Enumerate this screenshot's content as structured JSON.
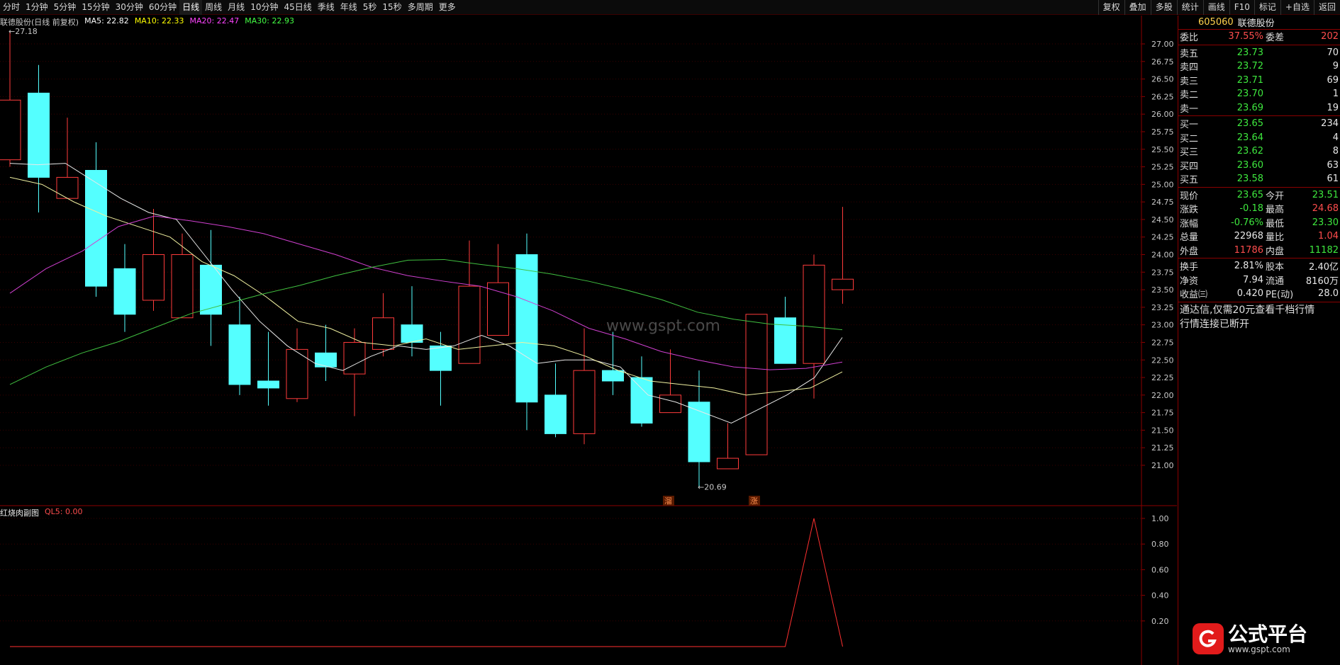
{
  "toolbar": {
    "periods": [
      "分时",
      "1分钟",
      "5分钟",
      "15分钟",
      "30分钟",
      "60分钟",
      "日线",
      "周线",
      "月线",
      "10分钟",
      "45日线",
      "季线",
      "年线",
      "5秒",
      "15秒",
      "多周期",
      "更多"
    ],
    "active_period": "日线",
    "right_buttons": [
      "复权",
      "叠加",
      "多股",
      "统计",
      "画线",
      "F10",
      "标记",
      "+自选",
      "返回"
    ]
  },
  "legend": {
    "title": "联德股份(日线 前复权)",
    "ma5": "MA5: 22.82",
    "ma10": "MA10: 22.33",
    "ma20": "MA20: 22.47",
    "ma30": "MA30: 22.93",
    "high_marker": "27.18",
    "low_marker": "20.69",
    "tag1": "溜",
    "tag2": "涨"
  },
  "sub_legend": {
    "title": "红烧肉副图",
    "ql5": "QL5: 0.00"
  },
  "watermark": "www.gspt.com",
  "colors": {
    "up": "#ff3b3b",
    "down": "#54ffff",
    "ma5": "#ffffff",
    "ma10": "#ffff00",
    "ma20": "#ff44ff",
    "ma30": "#44ff44",
    "grid": "#3a0000",
    "axis": "#8b0000"
  },
  "chart_data": [
    {
      "type": "candlestick",
      "title": "联德股份(日线 前复权)",
      "y_ticks": [
        21.0,
        21.25,
        21.5,
        21.75,
        22.0,
        22.25,
        22.5,
        22.75,
        23.0,
        23.25,
        23.5,
        23.75,
        24.0,
        24.25,
        24.5,
        24.75,
        25.0,
        25.25,
        25.5,
        25.75,
        26.0,
        26.25,
        26.5,
        26.75,
        27.0
      ],
      "ylim": [
        20.5,
        27.2
      ],
      "candles": [
        {
          "o": 25.35,
          "c": 26.2,
          "h": 27.18,
          "l": 25.25
        },
        {
          "o": 26.3,
          "c": 25.1,
          "h": 26.7,
          "l": 24.6
        },
        {
          "o": 24.8,
          "c": 25.1,
          "h": 25.95,
          "l": 24.8
        },
        {
          "o": 25.2,
          "c": 23.55,
          "h": 25.6,
          "l": 23.4
        },
        {
          "o": 23.8,
          "c": 23.15,
          "h": 24.15,
          "l": 22.9
        },
        {
          "o": 23.35,
          "c": 24.0,
          "h": 24.65,
          "l": 23.2
        },
        {
          "o": 23.1,
          "c": 24.0,
          "h": 24.3,
          "l": 23.1
        },
        {
          "o": 23.85,
          "c": 23.15,
          "h": 24.35,
          "l": 22.7
        },
        {
          "o": 23.0,
          "c": 22.15,
          "h": 23.4,
          "l": 22.0
        },
        {
          "o": 22.2,
          "c": 22.1,
          "h": 22.9,
          "l": 21.85
        },
        {
          "o": 21.95,
          "c": 22.65,
          "h": 22.95,
          "l": 21.9
        },
        {
          "o": 22.6,
          "c": 22.4,
          "h": 23.0,
          "l": 22.2
        },
        {
          "o": 22.3,
          "c": 22.75,
          "h": 22.95,
          "l": 21.7
        },
        {
          "o": 22.65,
          "c": 23.1,
          "h": 23.45,
          "l": 22.55
        },
        {
          "o": 23.0,
          "c": 22.75,
          "h": 23.55,
          "l": 22.55
        },
        {
          "o": 22.7,
          "c": 22.35,
          "h": 22.9,
          "l": 21.85
        },
        {
          "o": 22.45,
          "c": 23.55,
          "h": 24.2,
          "l": 22.45
        },
        {
          "o": 22.85,
          "c": 23.6,
          "h": 24.15,
          "l": 22.85
        },
        {
          "o": 24.0,
          "c": 21.9,
          "h": 24.3,
          "l": 21.5
        },
        {
          "o": 22.0,
          "c": 21.45,
          "h": 22.45,
          "l": 21.4
        },
        {
          "o": 21.45,
          "c": 22.35,
          "h": 22.95,
          "l": 21.3
        },
        {
          "o": 22.35,
          "c": 22.2,
          "h": 22.9,
          "l": 22.0
        },
        {
          "o": 22.25,
          "c": 21.6,
          "h": 22.55,
          "l": 21.55
        },
        {
          "o": 21.75,
          "c": 22.0,
          "h": 22.65,
          "l": 21.75
        },
        {
          "o": 21.9,
          "c": 21.05,
          "h": 22.35,
          "l": 20.69
        },
        {
          "o": 20.95,
          "c": 21.1,
          "h": 21.6,
          "l": 20.95
        },
        {
          "o": 21.15,
          "c": 23.15,
          "h": 23.15,
          "l": 21.15
        },
        {
          "o": 23.1,
          "c": 22.45,
          "h": 23.4,
          "l": 22.45
        },
        {
          "o": 22.45,
          "c": 23.85,
          "h": 24.0,
          "l": 21.95
        },
        {
          "o": 23.5,
          "c": 23.65,
          "h": 24.68,
          "l": 23.3
        }
      ],
      "ma5": [
        25.3,
        25.28,
        25.3,
        25.05,
        24.8,
        24.6,
        24.5,
        24.0,
        23.5,
        23.05,
        22.7,
        22.45,
        22.35,
        22.55,
        22.7,
        22.65,
        22.7,
        22.85,
        22.7,
        22.45,
        22.5,
        22.5,
        22.4,
        22.0,
        21.9,
        21.75,
        21.6,
        21.8,
        22.0,
        22.25,
        22.82
      ],
      "ma10": [
        25.1,
        25.0,
        24.75,
        24.55,
        24.4,
        24.25,
        23.9,
        23.7,
        23.4,
        23.05,
        22.95,
        22.75,
        22.7,
        22.8,
        22.65,
        22.7,
        22.75,
        22.7,
        22.55,
        22.35,
        22.2,
        22.15,
        22.1,
        22.0,
        22.05,
        22.1,
        22.33
      ],
      "ma20": [
        23.45,
        23.8,
        24.05,
        24.4,
        24.55,
        24.48,
        24.4,
        24.3,
        24.15,
        24.0,
        23.82,
        23.7,
        23.62,
        23.55,
        23.4,
        23.2,
        22.95,
        22.8,
        22.62,
        22.5,
        22.4,
        22.36,
        22.38,
        22.47
      ],
      "ma30": [
        22.15,
        22.4,
        22.6,
        22.76,
        22.96,
        23.16,
        23.3,
        23.44,
        23.56,
        23.7,
        23.82,
        23.92,
        23.93,
        23.86,
        23.8,
        23.72,
        23.62,
        23.5,
        23.36,
        23.18,
        23.08,
        23.01,
        22.98,
        22.93
      ]
    },
    {
      "type": "line",
      "title": "红烧肉副图",
      "y_ticks": [
        0.2,
        0.4,
        0.6,
        0.8,
        1.0
      ],
      "series": [
        {
          "name": "QL5",
          "values": [
            0,
            0,
            0,
            0,
            0,
            0,
            0,
            0,
            0,
            0,
            0,
            0,
            0,
            0,
            0,
            0,
            0,
            0,
            0,
            0,
            0,
            0,
            0,
            0,
            0,
            0,
            0,
            0,
            1,
            0
          ]
        }
      ]
    }
  ],
  "quote": {
    "code": "605060",
    "name": "联德股份",
    "weibi_label": "委比",
    "weibi": "37.55%",
    "weicha_label": "委差",
    "weicha": "202",
    "sells": [
      {
        "label": "卖五",
        "price": "23.73",
        "vol": "70"
      },
      {
        "label": "卖四",
        "price": "23.72",
        "vol": "9"
      },
      {
        "label": "卖三",
        "price": "23.71",
        "vol": "69"
      },
      {
        "label": "卖二",
        "price": "23.70",
        "vol": "1"
      },
      {
        "label": "卖一",
        "price": "23.69",
        "vol": "19"
      }
    ],
    "buys": [
      {
        "label": "买一",
        "price": "23.65",
        "vol": "234"
      },
      {
        "label": "买二",
        "price": "23.64",
        "vol": "4"
      },
      {
        "label": "买三",
        "price": "23.62",
        "vol": "8"
      },
      {
        "label": "买四",
        "price": "23.60",
        "vol": "63"
      },
      {
        "label": "买五",
        "price": "23.58",
        "vol": "61"
      }
    ],
    "stats": [
      {
        "l1": "现价",
        "v1": "23.65",
        "c1": "green",
        "l2": "今开",
        "v2": "23.51",
        "c2": "green"
      },
      {
        "l1": "涨跌",
        "v1": "-0.18",
        "c1": "green",
        "l2": "最高",
        "v2": "24.68",
        "c2": "red"
      },
      {
        "l1": "涨幅",
        "v1": "-0.76%",
        "c1": "green",
        "l2": "最低",
        "v2": "23.30",
        "c2": "green"
      },
      {
        "l1": "总量",
        "v1": "22968",
        "c1": "white",
        "l2": "量比",
        "v2": "1.04",
        "c2": "red"
      },
      {
        "l1": "外盘",
        "v1": "11786",
        "c1": "red",
        "l2": "内盘",
        "v2": "11182",
        "c2": "green"
      }
    ],
    "stats2": [
      {
        "l1": "换手",
        "v1": "2.81%",
        "l2": "股本",
        "v2": "2.40亿"
      },
      {
        "l1": "净资",
        "v1": "7.94",
        "l2": "流通",
        "v2": "8160万"
      },
      {
        "l1": "收益㈢",
        "v1": "0.420",
        "l2": "PE(动)",
        "v2": "28.0"
      }
    ],
    "notice1": "通达信,仅需20元查看千档行情",
    "notice2": "行情连接已断开"
  },
  "logo": {
    "text": "公式平台",
    "sub": "www.gspt.com"
  }
}
